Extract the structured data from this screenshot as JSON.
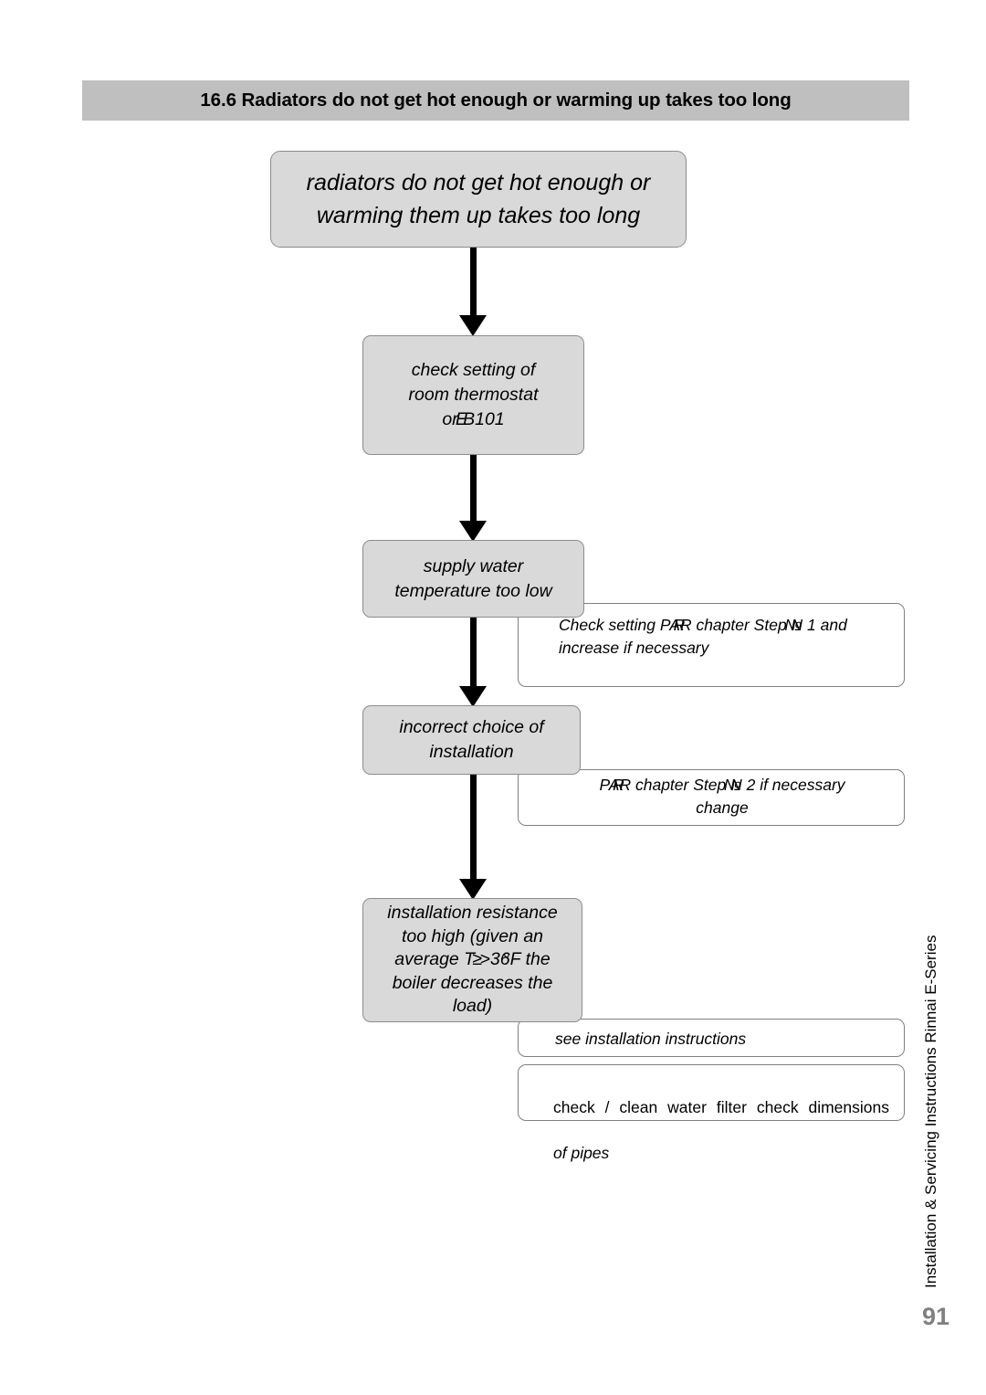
{
  "section": {
    "number": "16.6",
    "title": "16.6 Radiators do not get hot enough or warming up takes too long"
  },
  "flowchart": {
    "type": "troubleshooting-flowchart",
    "nodes": [
      {
        "id": "problem",
        "kind": "problem",
        "text": "radiators do not get hot enough or\nwarming them up takes too long"
      },
      {
        "id": "thermostat",
        "kind": "check-step",
        "text_line1": "check setting of",
        "text_line2": "room thermostat",
        "text_line3_prefix": "or ",
        "text_line3_overlap_a": "E",
        "text_line3_overlap_b": "B",
        "text_line3_suffix": "101",
        "text_plain": "check setting of room thermostat or E101"
      },
      {
        "id": "supply",
        "kind": "cause",
        "text": "supply water\ntemperature too low"
      },
      {
        "id": "choice",
        "kind": "cause",
        "text": "incorrect choice of\ninstallation"
      },
      {
        "id": "resistance",
        "kind": "cause",
        "line1": "installation resistance",
        "line2": "too high (given an",
        "line3_prefix": "average T ",
        "line3_overlap_a": ">",
        "line3_overlap_b": "≥",
        "line3_mid": "36",
        "line3_overlap_c": "F",
        "line3_overlap_d": "°",
        "line3_suffix": " the",
        "line4": "boiler decreases the",
        "line5": "load)",
        "text_plain": "installation resistance too high (given an average T >36 F the boiler decreases the load)"
      }
    ],
    "notes": [
      {
        "id": "par1",
        "prefix": "Check setting PA",
        "overlap_a": "R",
        "overlap_b": "R",
        "mid": " chapter Step ",
        "overlap_c": "N",
        "overlap_d": "№",
        "suffix": " 1 and\nincrease if necessary",
        "text_plain": "Check setting PAR chapter Step N 1 and increase if necessary"
      },
      {
        "id": "par2",
        "prefix": "PA",
        "overlap_a": "R",
        "overlap_b": "R",
        "mid": " chapter Step ",
        "overlap_c": "N",
        "overlap_d": "№",
        "suffix": " 2 if necessary\nchange",
        "text_plain": "PAR chapter Step N 2 if necessary change"
      },
      {
        "id": "see-installation",
        "text": "see installation instructions"
      },
      {
        "id": "filter",
        "line1": "check / clean water filter check dimensions",
        "line2": "of pipes",
        "text_plain": "check / clean water filter check dimensions of pipes"
      }
    ],
    "arrows": [
      {
        "id": "arrow1",
        "from": "problem",
        "to": "thermostat"
      },
      {
        "id": "arrow2",
        "from": "thermostat",
        "to": "supply"
      },
      {
        "id": "arrow3",
        "from": "supply",
        "to": "choice"
      },
      {
        "id": "arrow4",
        "from": "choice",
        "to": "resistance"
      }
    ]
  },
  "footer": {
    "side_label": "Installation & Servicing Instructions Rinnai E-Series",
    "page_number": "91"
  },
  "colors": {
    "header_band": "#bfbfbf",
    "node_fill": "#d9d9d9",
    "node_border": "#8c8c8c",
    "note_fill": "#ffffff",
    "note_border": "#808080",
    "arrow": "#000000",
    "page_number": "#808080",
    "text": "#000000"
  }
}
